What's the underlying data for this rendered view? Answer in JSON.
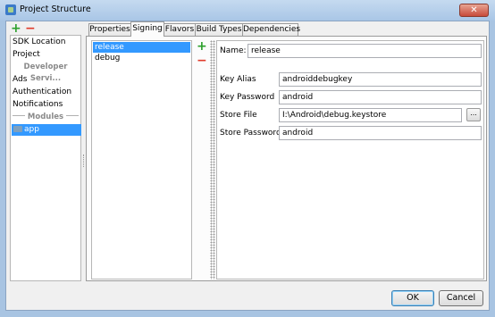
{
  "window": {
    "title": "Project Structure",
    "close_label": "✕"
  },
  "left_panel": {
    "add_label": "+",
    "remove_label": "−",
    "items": [
      {
        "label": "SDK Location"
      },
      {
        "label": "Project"
      }
    ],
    "developer_services_header": "Developer Servi...",
    "service_items": [
      {
        "label": "Ads"
      },
      {
        "label": "Authentication"
      },
      {
        "label": "Notifications"
      }
    ],
    "modules_header": "Modules",
    "modules": [
      {
        "label": "app",
        "selected": true
      }
    ]
  },
  "tabs": [
    {
      "label": "Properties",
      "active": false
    },
    {
      "label": "Signing",
      "active": true
    },
    {
      "label": "Flavors",
      "active": false
    },
    {
      "label": "Build Types",
      "active": false
    },
    {
      "label": "Dependencies",
      "active": false
    }
  ],
  "signing": {
    "configs": [
      {
        "label": "release",
        "selected": true
      },
      {
        "label": "debug",
        "selected": false
      }
    ],
    "add_label": "+",
    "remove_label": "−",
    "fields": {
      "name": {
        "label": "Name:",
        "value": "release"
      },
      "key_alias": {
        "label": "Key Alias",
        "value": "androiddebugkey"
      },
      "key_password": {
        "label": "Key Password",
        "value": "android"
      },
      "store_file": {
        "label": "Store File",
        "value": "I:\\Android\\debug.keystore",
        "browse_label": "..."
      },
      "store_password": {
        "label": "Store Password",
        "value": "android"
      }
    }
  },
  "buttons": {
    "ok": "OK",
    "cancel": "Cancel"
  },
  "colors": {
    "selection": "#3399ff",
    "add": "#2ca02c",
    "remove": "#e03a2a"
  },
  "icons": [
    "app-icon",
    "add-icon",
    "remove-icon",
    "module-icon",
    "close-icon"
  ]
}
